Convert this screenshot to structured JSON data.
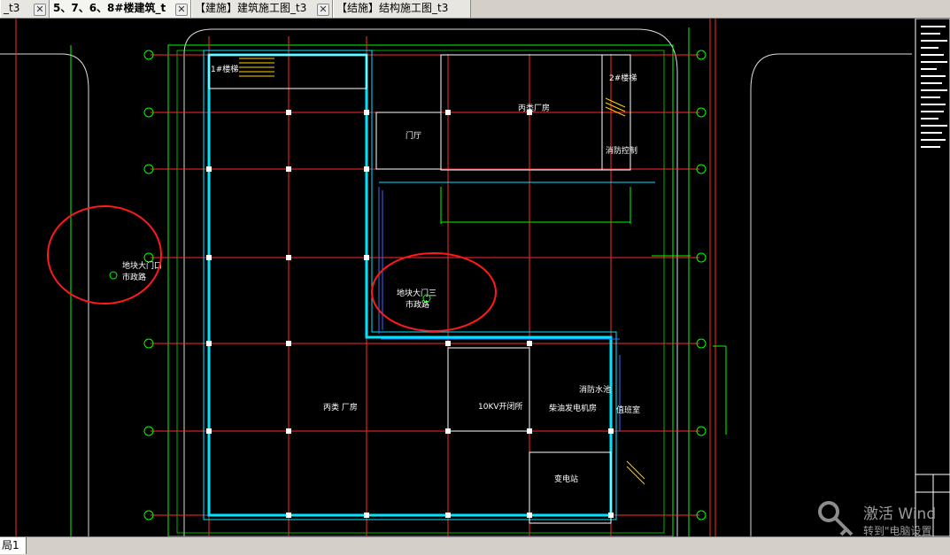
{
  "tabs": [
    {
      "label": "_t3",
      "active": false
    },
    {
      "label": "5、7、6、8#楼建筑_t",
      "active": true
    },
    {
      "label": "【建施】建筑施工图_t3",
      "active": false
    },
    {
      "label": "【结施】结构施工图_t3",
      "active": false
    }
  ],
  "close_glyph": "✕",
  "layout_tab": "局1",
  "drawing": {
    "rooms": {
      "stair1": "1#楼梯",
      "stair2": "2#楼梯",
      "office": "消防控制",
      "plant1": "丙类厂房",
      "plant2": "丙类 厂房",
      "room_10kv": "10KV开闭所",
      "room_power": "变电站",
      "room_gen": "柴油发电机房",
      "room_hall": "门厅",
      "room_misc": "消防水池",
      "room_small": "值班室"
    },
    "annotations": {
      "left_label1": "地块大门口",
      "left_label2": "市政路",
      "mid_label1": "地块大门三",
      "mid_label2": "市政路"
    }
  },
  "watermark": {
    "line1": "激活 Wind",
    "line2": "转到\"电脑设置"
  },
  "colors": {
    "background": "#000000",
    "grid": "#ff2a2a",
    "wall": "#00e5ff",
    "line": "#00ff00",
    "room": "#ffffff",
    "annotation_circle": "#ff1a1a"
  }
}
